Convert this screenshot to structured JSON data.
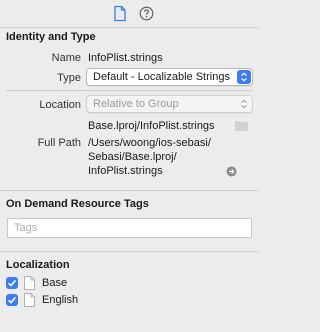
{
  "toolbar": {
    "file_inspector_icon": "file-icon",
    "help_icon": "help-icon",
    "accent_color": "#3d7cf0"
  },
  "identity": {
    "header": "Identity and Type",
    "name_label": "Name",
    "name_value": "InfoPlist.strings",
    "type_label": "Type",
    "type_value": "Default - Localizable Strings",
    "location_label": "Location",
    "location_value": "Relative to Group",
    "location_path": "Base.lproj/InfoPlist.strings",
    "fullpath_label": "Full Path",
    "fullpath_lines": [
      "/Users/woong/ios-sebasi/",
      "Sebasi/Base.lproj/",
      "InfoPlist.strings"
    ]
  },
  "on_demand": {
    "header": "On Demand Resource Tags",
    "tags_placeholder": "Tags"
  },
  "localization": {
    "header": "Localization",
    "items": [
      {
        "label": "Base",
        "checked": true
      },
      {
        "label": "English",
        "checked": true
      }
    ]
  }
}
